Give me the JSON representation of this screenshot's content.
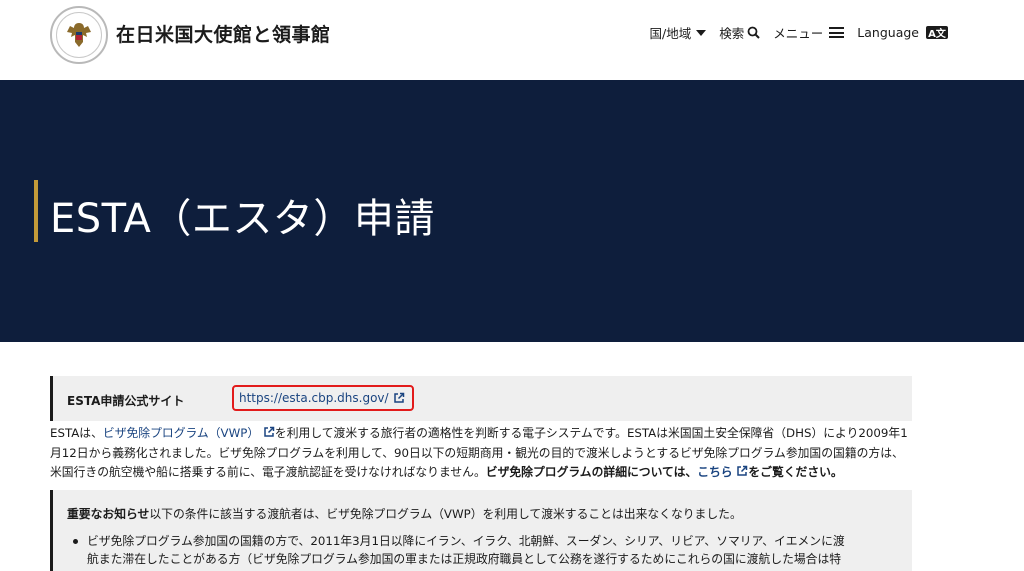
{
  "header": {
    "site_title": "在日米国大使館と領事館",
    "nav": {
      "region": "国/地域",
      "search": "検索",
      "menu": "メニュー",
      "language": "Language",
      "language_badge": "A文"
    }
  },
  "hero": {
    "title": "ESTA（エスタ）申請"
  },
  "callout": {
    "label": "ESTA申請公式サイト",
    "link_text": "https://esta.cbp.dhs.gov/"
  },
  "intro": {
    "line1_a": "ESTAは、",
    "line1_link": "ビザ免除プログラム（VWP）",
    "line1_b": "を利用して渡米する旅行者の適格性を判断する電子システムです。ESTAは米国国土安全保障省（DHS）により2009年1",
    "line2": "月12日から義務化されました。ビザ免除プログラムを利用して、90日以下の短期商用・観光の目的で渡米しようとするビザ免除プログラム参加国の国籍の方は、",
    "line3_a": "米国行きの航空機や船に搭乗する前に、電子渡航認証を受けなければなりません。",
    "line3_bold": "ビザ免除プログラムの詳細については、",
    "line3_link": "こちら",
    "line3_end": "をご覧ください。"
  },
  "notice": {
    "head_bold": "重要なお知らせ",
    "head_text": "以下の条件に該当する渡航者は、ビザ免除プログラム（VWP）を利用して渡米することは出来なくなりました。",
    "bullet_line1": "ビザ免除プログラム参加国の国籍の方で、2011年3月1日以降にイラン、イラク、北朝鮮、スーダン、シリア、リビア、ソマリア、イエメンに渡",
    "bullet_line2": "航また滞在したことがある方（ビザ免除プログラム参加国の軍または正規政府職員として公務を遂行するためにこれらの国に渡航した場合は特"
  }
}
